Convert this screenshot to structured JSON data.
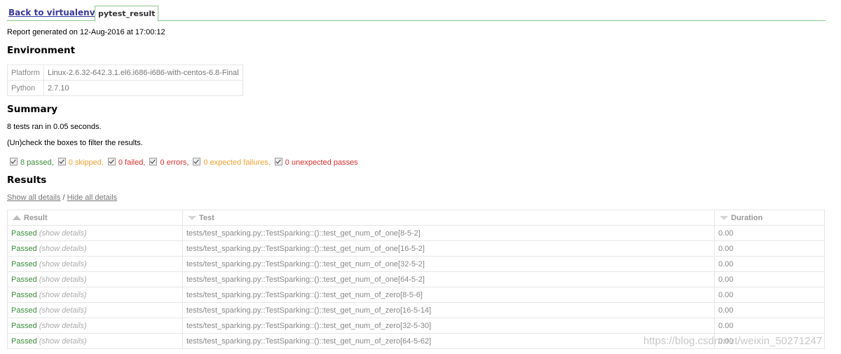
{
  "tabs": {
    "back_label": "Back to virtualenv",
    "active_label": "pytest_result"
  },
  "report_line": "Report generated on 12-Aug-2016 at 17:00:12",
  "environment": {
    "heading": "Environment",
    "rows": [
      {
        "key": "Platform",
        "value": "Linux-2.6.32-642.3.1.el6.i686-i686-with-centos-6.8-Final"
      },
      {
        "key": "Python",
        "value": "2.7.10"
      }
    ]
  },
  "summary": {
    "heading": "Summary",
    "ran_text": "8 tests ran in 0.05 seconds.",
    "filter_hint": "(Un)check the boxes to filter the results.",
    "filters": [
      {
        "label": "8 passed",
        "sep": ",",
        "color": "#3b8b3b"
      },
      {
        "label": "0 skipped",
        "sep": ",",
        "color": "#f0a030"
      },
      {
        "label": "0 failed",
        "sep": ",",
        "color": "#e03030"
      },
      {
        "label": "0 errors",
        "sep": ",",
        "color": "#e03030"
      },
      {
        "label": "0 expected failures",
        "sep": ",",
        "color": "#f0a030"
      },
      {
        "label": "0 unexpected passes",
        "sep": "",
        "color": "#e03030"
      }
    ]
  },
  "results": {
    "heading": "Results",
    "show_all": "Show all details",
    "separator": " / ",
    "hide_all": "Hide all details",
    "columns": [
      "Result",
      "Test",
      "Duration"
    ],
    "rows": [
      {
        "result": "Passed",
        "details": "(show details)",
        "test": "tests/test_sparking.py::TestSparking::()::test_get_num_of_one[8-5-2]",
        "duration": "0.00"
      },
      {
        "result": "Passed",
        "details": "(show details)",
        "test": "tests/test_sparking.py::TestSparking::()::test_get_num_of_one[16-5-2]",
        "duration": "0.00"
      },
      {
        "result": "Passed",
        "details": "(show details)",
        "test": "tests/test_sparking.py::TestSparking::()::test_get_num_of_one[32-5-2]",
        "duration": "0.00"
      },
      {
        "result": "Passed",
        "details": "(show details)",
        "test": "tests/test_sparking.py::TestSparking::()::test_get_num_of_one[64-5-2]",
        "duration": "0.00"
      },
      {
        "result": "Passed",
        "details": "(show details)",
        "test": "tests/test_sparking.py::TestSparking::()::test_get_num_of_zero[8-5-6]",
        "duration": "0.00"
      },
      {
        "result": "Passed",
        "details": "(show details)",
        "test": "tests/test_sparking.py::TestSparking::()::test_get_num_of_zero[16-5-14]",
        "duration": "0.00"
      },
      {
        "result": "Passed",
        "details": "(show details)",
        "test": "tests/test_sparking.py::TestSparking::()::test_get_num_of_zero[32-5-30]",
        "duration": "0.00"
      },
      {
        "result": "Passed",
        "details": "(show details)",
        "test": "tests/test_sparking.py::TestSparking::()::test_get_num_of_zero[64-5-62]",
        "duration": "0.00"
      }
    ]
  },
  "watermark": "https://blog.csdn.net/weixin_50271247"
}
